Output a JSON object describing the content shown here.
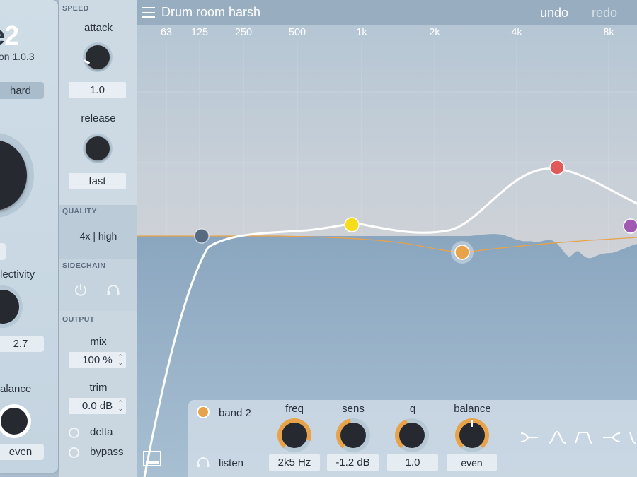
{
  "header": {
    "preset_name": "Drum room harsh",
    "undo_label": "undo",
    "redo_label": "redo"
  },
  "freq_axis": [
    "63",
    "125",
    "250",
    "500",
    "1k",
    "2k",
    "4k",
    "8k"
  ],
  "left_panel": {
    "logo_text": "e",
    "logo_number": "2",
    "version": "on 1.0.3",
    "mode": "hard",
    "selectivity_label": "lectivity",
    "selectivity_value": "2.7",
    "balance_label": "alance",
    "balance_value": "even"
  },
  "speed": {
    "title": "SPEED",
    "attack_label": "attack",
    "attack_value": "1.0",
    "release_label": "release",
    "release_value": "fast"
  },
  "quality": {
    "title": "QUALITY",
    "value": "4x | high"
  },
  "sidechain": {
    "title": "SIDECHAIN"
  },
  "output": {
    "title": "OUTPUT",
    "mix_label": "mix",
    "mix_value": "100 %",
    "trim_label": "trim",
    "trim_value": "0.0 dB",
    "delta_label": "delta",
    "bypass_label": "bypass"
  },
  "band": {
    "name": "band 2",
    "listen_label": "listen",
    "freq_label": "freq",
    "freq_value": "2k5 Hz",
    "sens_label": "sens",
    "sens_value": "-1.2 dB",
    "q_label": "q",
    "q_value": "1.0",
    "balance_label": "balance",
    "balance_value": "even"
  },
  "colors": {
    "band1": "#566a80",
    "band2": "#e8a24a",
    "band3": "#f6dc1a",
    "band4": "#e05a5a",
    "band5": "#a05ab4",
    "accent_orange": "#e8a24a"
  }
}
